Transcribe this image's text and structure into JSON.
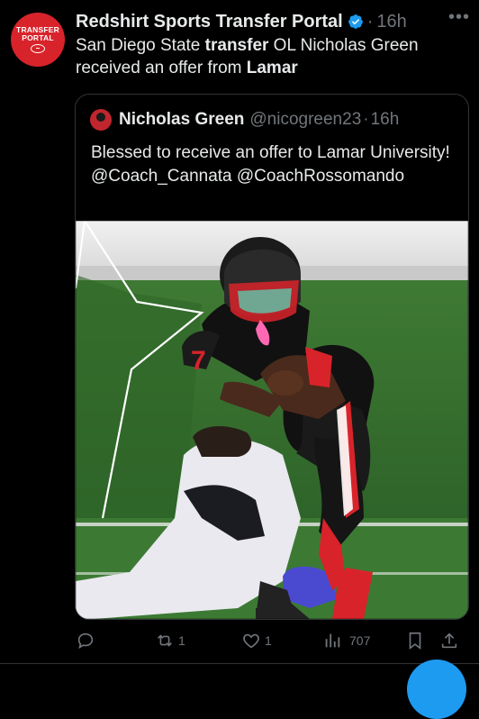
{
  "account": {
    "avatar_line1": "TRANSFER",
    "avatar_line2": "PORTAL",
    "name": "Redshirt Sports Transfer Portal",
    "time": "16h"
  },
  "tweet": {
    "pre1": "San Diego State ",
    "bold1": "transfer",
    "mid": " OL Nicholas Green received an offer from ",
    "bold2": "Lamar"
  },
  "quote": {
    "name": "Nicholas Green",
    "handle": "@nicogreen23",
    "time": "16h",
    "text": "Blessed to receive an offer to Lamar University! @Coach_Cannata @CoachRossomando",
    "helmet_number": "7"
  },
  "actions": {
    "retweets": "1",
    "likes": "1",
    "views": "707"
  },
  "colors": {
    "accent": "#1d9bf0",
    "brand_red": "#d8232a"
  }
}
